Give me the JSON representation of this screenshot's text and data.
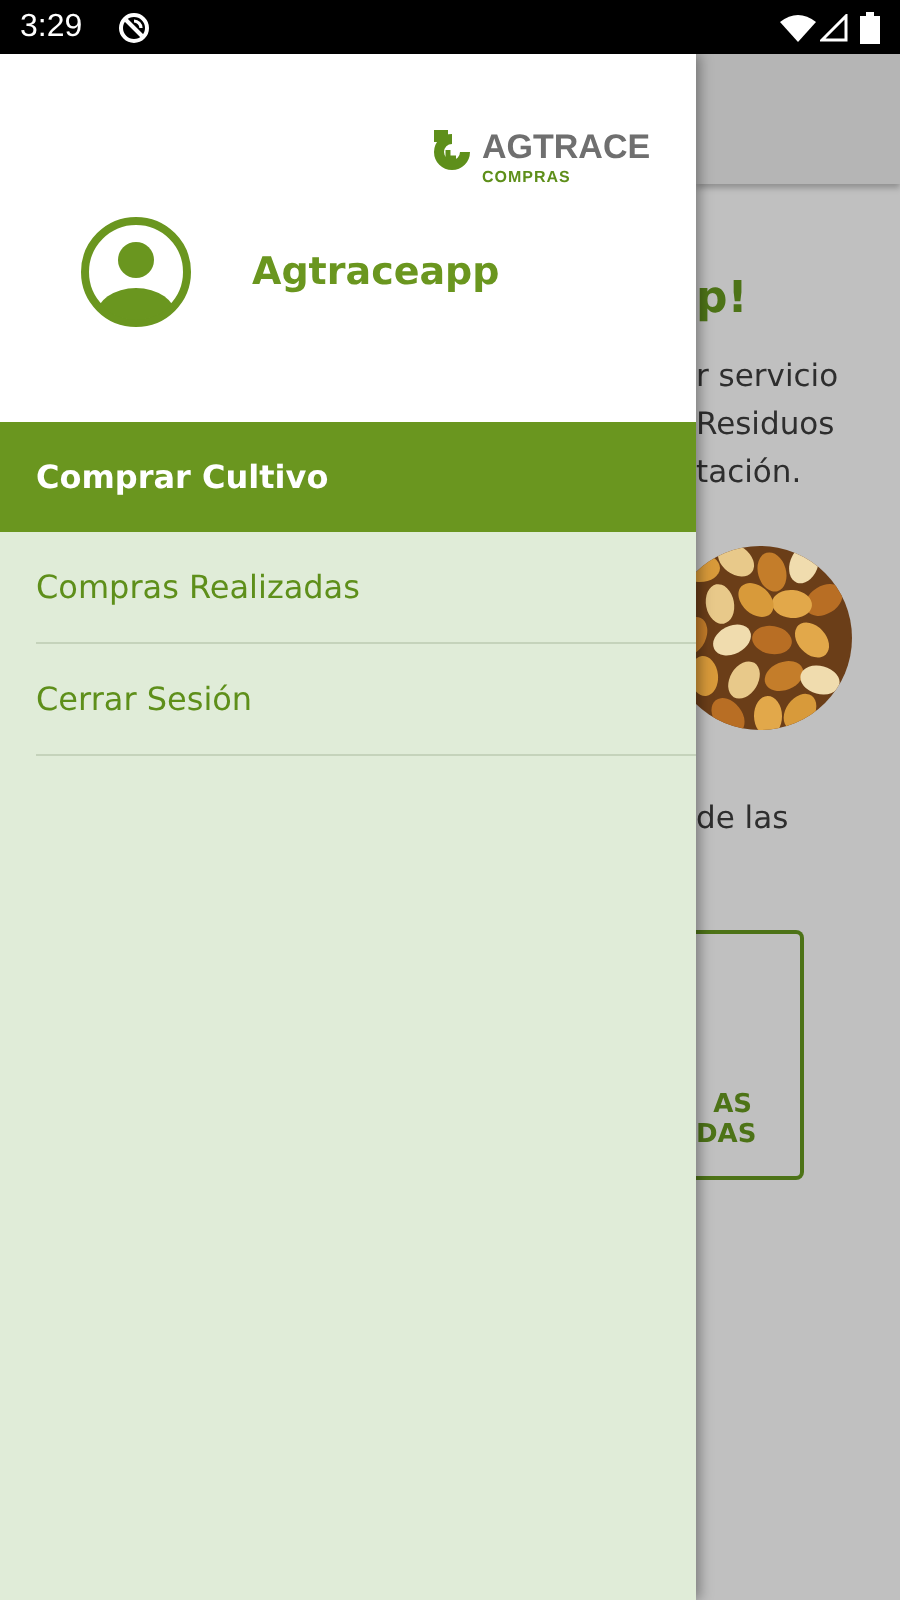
{
  "status_bar": {
    "time": "3:29"
  },
  "drawer": {
    "logo": {
      "name": "AGTRACE",
      "subtitle": "COMPRAS"
    },
    "user": "Agtraceapp",
    "items": [
      {
        "label": "Comprar Cultivo",
        "selected": true
      },
      {
        "label": "Compras Realizadas",
        "selected": false
      },
      {
        "label": "Cerrar Sesión",
        "selected": false
      }
    ]
  },
  "background_page": {
    "title": "p!",
    "text_lines": [
      "r servicio",
      "Residuos",
      "tación."
    ],
    "text_after": "de las",
    "button_lines": [
      "AS",
      "DAS"
    ]
  }
}
